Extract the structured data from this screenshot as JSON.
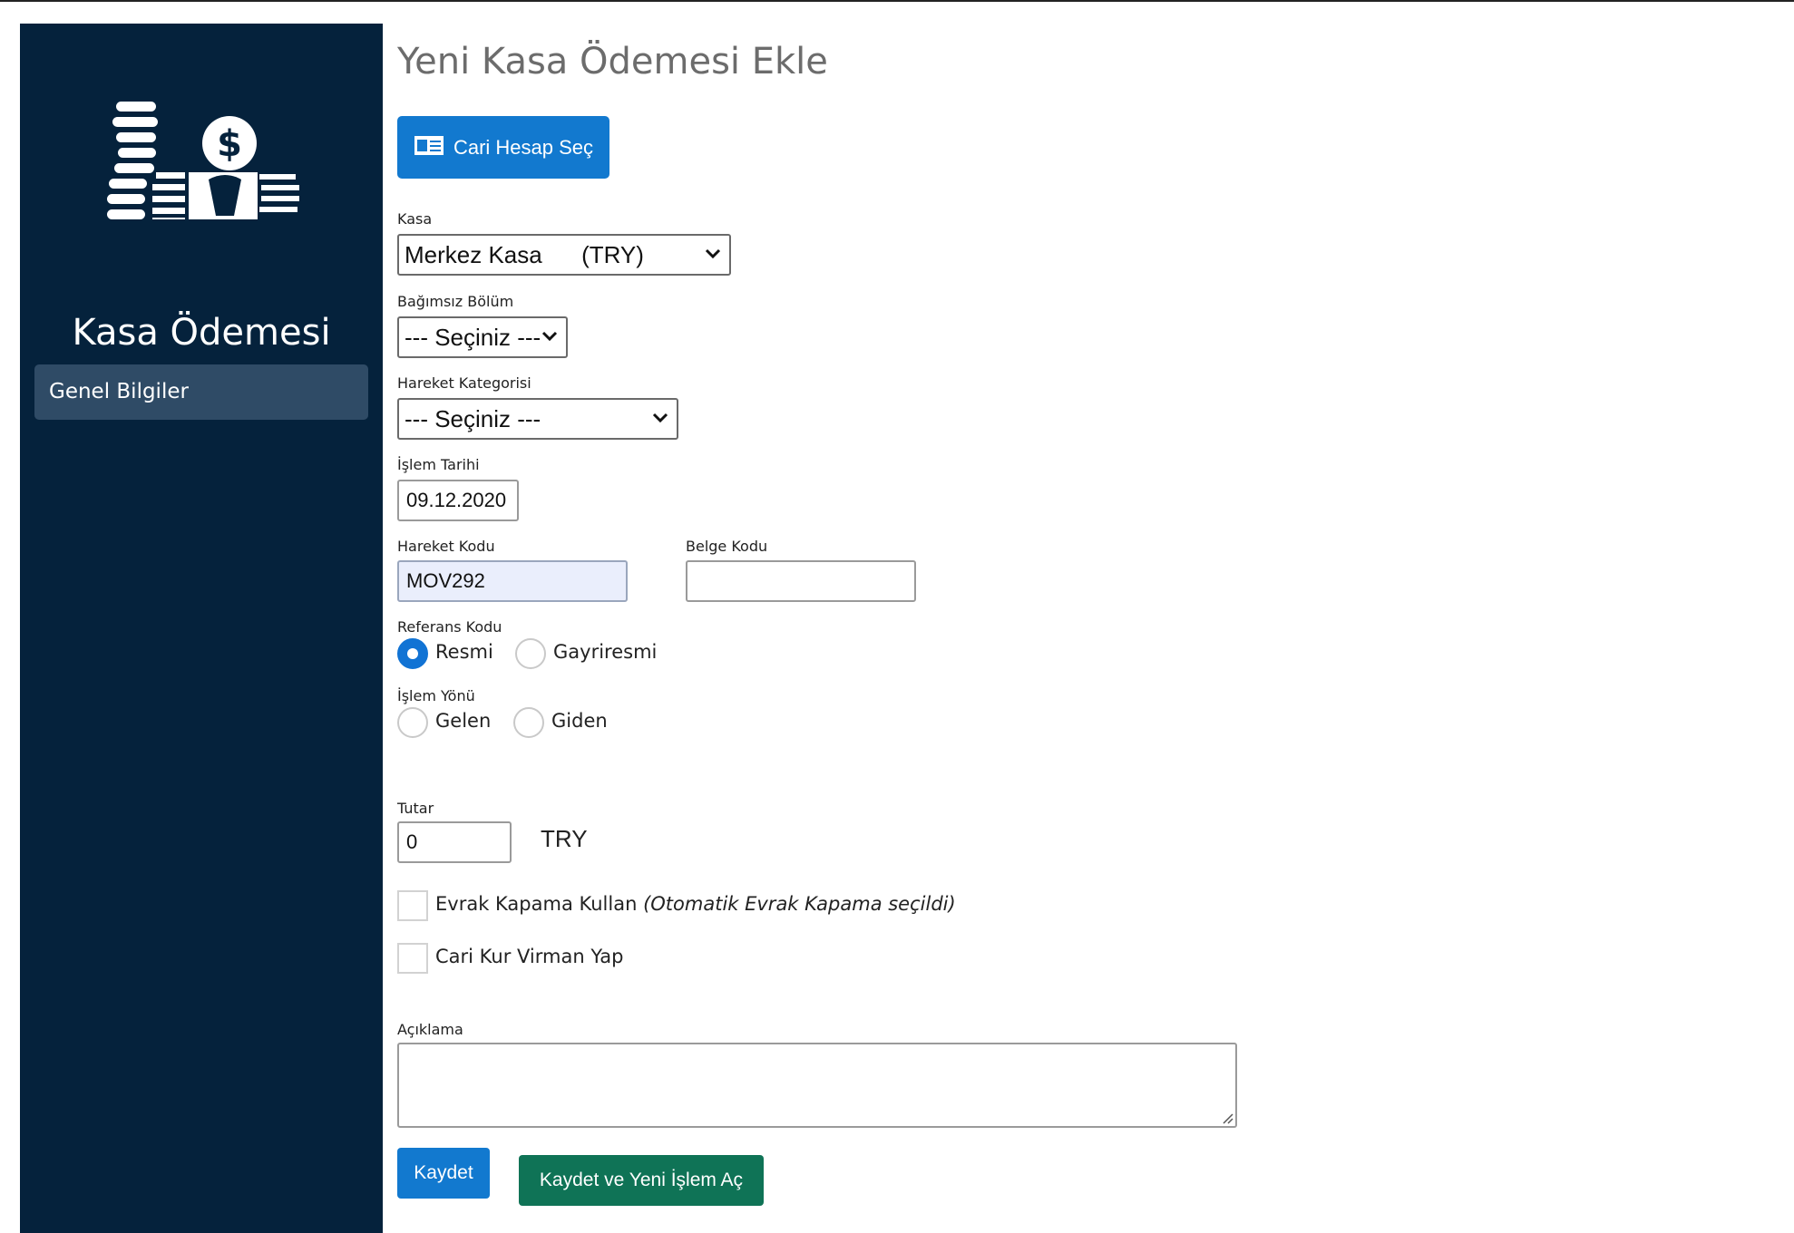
{
  "sidebar": {
    "title": "Kasa Ödemesi",
    "items": [
      {
        "label": "Genel Bilgiler"
      }
    ],
    "logo_icon": "cash-coins-icon"
  },
  "form": {
    "title": "Yeni Kasa Ödemesi Ekle",
    "cari_button": {
      "label": "Cari Hesap Seç",
      "icon": "id-card-icon"
    },
    "kasa": {
      "label": "Kasa",
      "value": "Merkez Kasa      (TRY)"
    },
    "bagimsiz_bolum": {
      "label": "Bağımsız Bölüm",
      "value": "--- Seçiniz ---"
    },
    "hareket_kategorisi": {
      "label": "Hareket Kategorisi",
      "value": "--- Seçiniz ---"
    },
    "islem_tarihi": {
      "label": "İşlem Tarihi",
      "value": "09.12.2020"
    },
    "hareket_kodu": {
      "label": "Hareket Kodu",
      "value": "MOV292"
    },
    "belge_kodu": {
      "label": "Belge Kodu",
      "value": ""
    },
    "referans_kodu": {
      "label": "Referans Kodu",
      "options": [
        {
          "label": "Resmi",
          "checked": true
        },
        {
          "label": "Gayriresmi",
          "checked": false
        }
      ]
    },
    "islem_yonu": {
      "label": "İşlem Yönü",
      "options": [
        {
          "label": "Gelen",
          "checked": false
        },
        {
          "label": "Giden",
          "checked": false
        }
      ]
    },
    "tutar": {
      "label": "Tutar",
      "value": "0",
      "currency": "TRY"
    },
    "evrak_kapama": {
      "label": "Evrak Kapama Kullan",
      "note": "(Otomatik Evrak Kapama seçildi)",
      "checked": false
    },
    "cari_kur_virman": {
      "label": "Cari Kur Virman Yap",
      "checked": false
    },
    "aciklama": {
      "label": "Açıklama",
      "value": ""
    },
    "save_button": "Kaydet",
    "save_new_button": "Kaydet ve Yeni İşlem Aç"
  },
  "colors": {
    "sidebar_bg": "#05223c",
    "sidebar_item_bg": "#2f4b66",
    "primary": "#1279cf",
    "success": "#0f7356"
  }
}
